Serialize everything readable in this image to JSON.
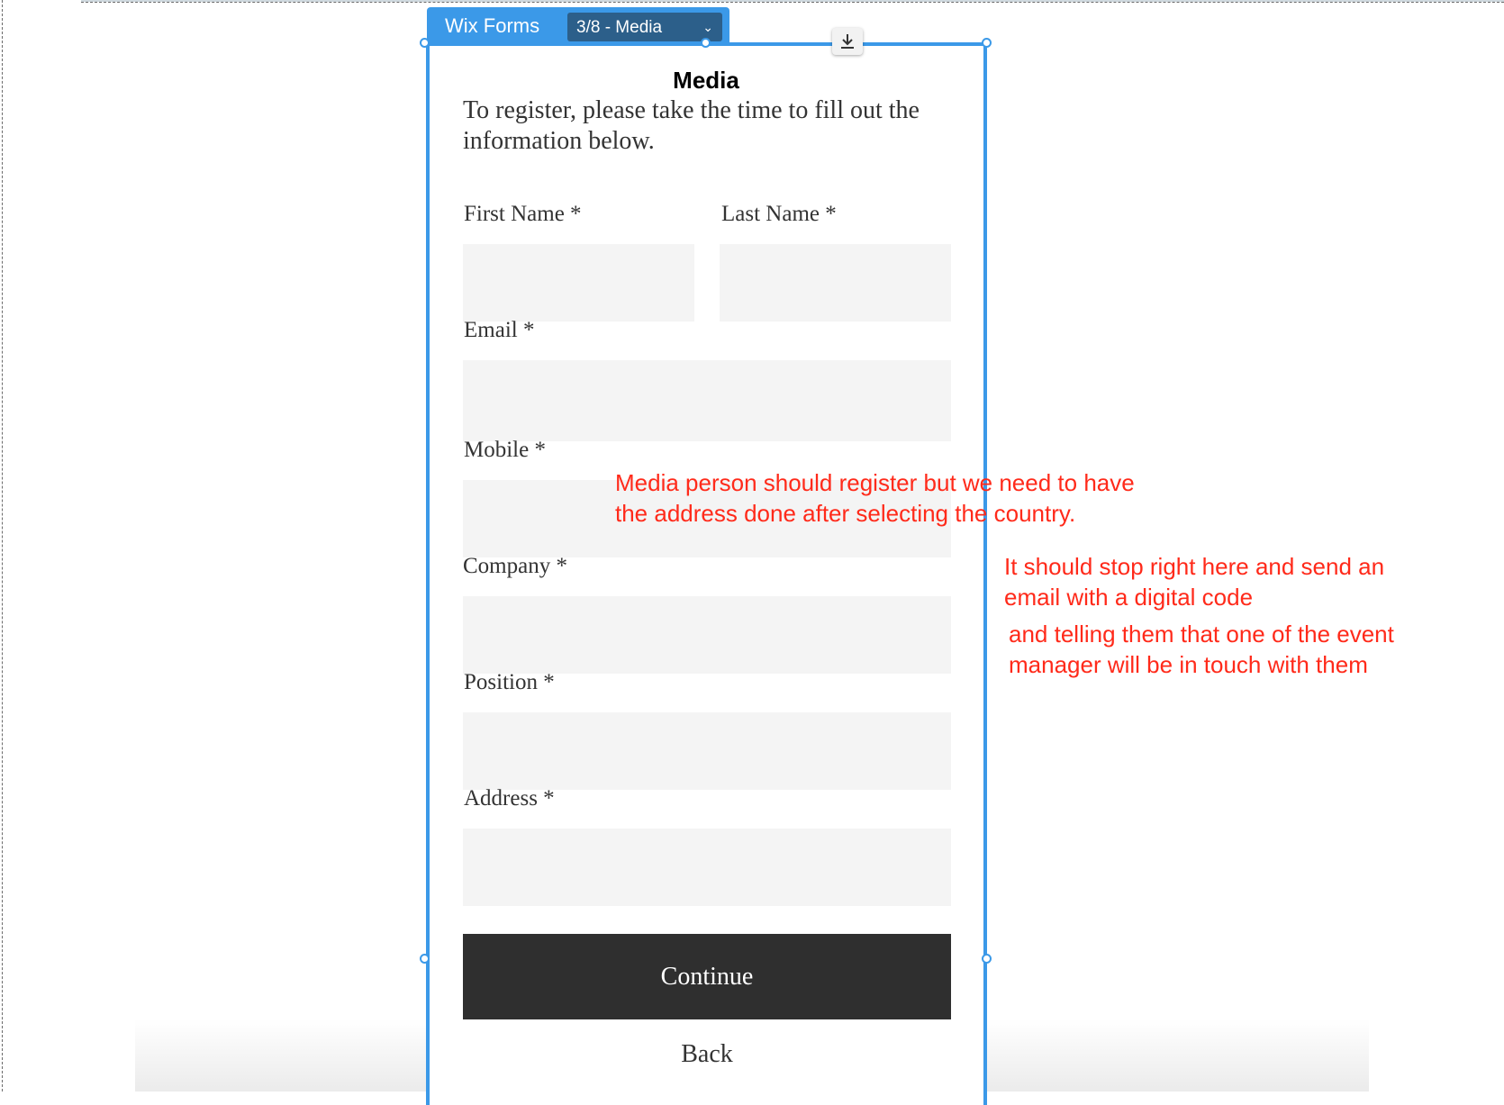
{
  "form_widget": {
    "app_name": "Wix Forms",
    "step_selector": "3/8 - Media"
  },
  "form": {
    "title": "Media",
    "intro": "To register, please take the time to fill out the information below.",
    "fields": {
      "first_name": "First Name *",
      "last_name": "Last Name *",
      "email": "Email *",
      "mobile": "Mobile *",
      "company": "Company *",
      "position": "Position *",
      "address": "Address *"
    },
    "continue_label": "Continue",
    "back_label": "Back"
  },
  "annotations": {
    "note_1_line_1": "Media person should register but we need to have",
    "note_1_line_2": "the address done after selecting the country.",
    "note_2_line_1": "It should stop right here and send an",
    "note_2_line_2": "email with a digital code",
    "note_3_line_1": "and telling them that one of the event",
    "note_3_line_2": "manager will be in touch with them"
  },
  "colors": {
    "selection": "#3b99e8",
    "field_bg": "#f4f4f4",
    "button_bg": "#2f2f2f",
    "annotation": "#ff2a1a"
  },
  "icons": {
    "download": "download-icon",
    "dropdown": "chevron-down-icon"
  }
}
